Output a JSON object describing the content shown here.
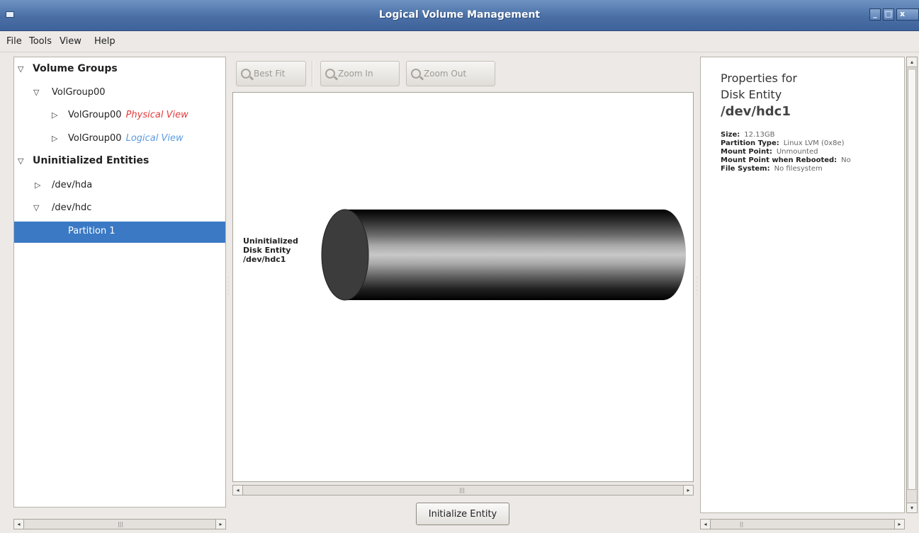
{
  "window": {
    "title": "Logical Volume Management",
    "minimize": "_",
    "maximize": "□",
    "close": "x"
  },
  "menu": [
    "File",
    "Tools",
    "View",
    "Help"
  ],
  "tree": {
    "volume_groups": "Volume Groups",
    "volgroup": "VolGroup00",
    "physical_name": "VolGroup00",
    "physical_tag": "Physical View",
    "logical_name": "VolGroup00",
    "logical_tag": "Logical View",
    "uninitialized": "Uninitialized Entities",
    "hda": "/dev/hda",
    "hdc": "/dev/hdc",
    "partition": "Partition 1"
  },
  "toolbar": {
    "best_fit": "Best Fit",
    "zoom_in": "Zoom In",
    "zoom_out": "Zoom Out"
  },
  "canvas": {
    "label_line1": "Uninitialized",
    "label_line2": "Disk Entity",
    "label_line3": "/dev/hdc1"
  },
  "init_button": "Initialize Entity",
  "properties": {
    "title_line1": "Properties for",
    "title_line2": "Disk Entity",
    "entity": "/dev/hdc1",
    "rows": [
      {
        "key": "Size:",
        "value": "12.13GB"
      },
      {
        "key": "Partition Type:",
        "value": "Linux LVM (0x8e)"
      },
      {
        "key": "Mount Point:",
        "value": "Unmounted"
      },
      {
        "key": "Mount Point when Rebooted:",
        "value": "No"
      },
      {
        "key": "File System:",
        "value": "No filesystem"
      }
    ]
  },
  "icons": {
    "expanded": "▽",
    "collapsed": "▷"
  }
}
